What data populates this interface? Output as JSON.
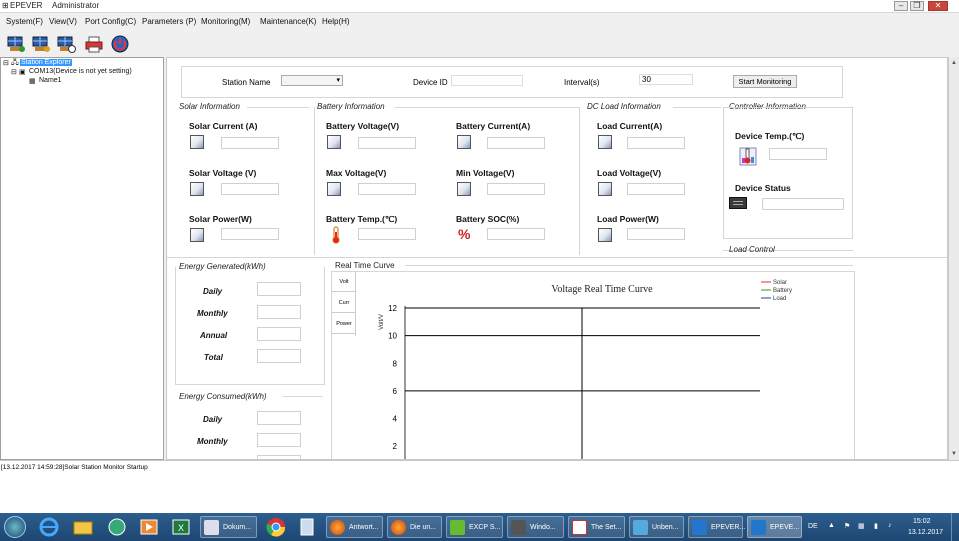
{
  "window": {
    "title_app": "EPEVER",
    "title_user": "Administrator",
    "controls": {
      "minimize": "–",
      "maximize": "❐",
      "close": "✕"
    }
  },
  "menu": [
    "System(F)",
    "View(V)",
    "Port Config(C)",
    "Parameters (P)",
    "Monitoring(M)",
    "Maintenance(K)",
    "Help(H)"
  ],
  "tree": {
    "root": "Station Explorer",
    "port": "COM13(Device is not yet setting)",
    "child": "Name1"
  },
  "station_bar": {
    "station_name_label": "Station Name",
    "device_id_label": "Device ID",
    "interval_label": "Interval(s)",
    "interval_value": "30",
    "start_button": "Start Monitoring"
  },
  "solar": {
    "group": "Solar Information",
    "current": "Solar Current (A)",
    "voltage": "Solar Voltage (V)",
    "power": "Solar Power(W)"
  },
  "battery": {
    "group": "Battery Information",
    "voltage": "Battery Voltage(V)",
    "current": "Battery Current(A)",
    "max_voltage": "Max Voltage(V)",
    "min_voltage": "Min Voltage(V)",
    "temp": "Battery Temp.(℃)",
    "soc": "Battery SOC(%)",
    "soc_icon": "%"
  },
  "dc_load": {
    "group": "DC Load Information",
    "current": "Load Current(A)",
    "voltage": "Load Voltage(V)",
    "power": "Load Power(W)"
  },
  "controller": {
    "group": "Controller Information",
    "temp": "Device Temp.(℃)",
    "status": "Device Status",
    "load_control": "Load Control"
  },
  "energy_generated": {
    "group": "Energy Generated(kWh)",
    "daily": "Daily",
    "monthly": "Monthly",
    "annual": "Annual",
    "total": "Total"
  },
  "energy_consumed": {
    "group": "Energy Consumed(kWh)",
    "daily": "Daily",
    "monthly": "Monthly"
  },
  "curve": {
    "group": "Real Time Curve",
    "tabs": [
      "Volt",
      "Curr",
      "Power"
    ]
  },
  "chart_data": {
    "type": "line",
    "title": "Voltage Real Time Curve",
    "ylabel": "Volt/V",
    "xlabel": "",
    "yticks": [
      2,
      4,
      6,
      8,
      10,
      12
    ],
    "ylim": [
      1,
      12
    ],
    "grid": true,
    "legend_position": "top-right",
    "series": [
      {
        "name": "Solar",
        "color": "#e03030",
        "values": []
      },
      {
        "name": "Battery",
        "color": "#2a9a2a",
        "values": []
      },
      {
        "name": "Load",
        "color": "#2a3aa8",
        "values": []
      }
    ]
  },
  "status_bar": {
    "log": "[13.12.2017 14:59:28]Solar Station Monitor Startup"
  },
  "taskbar": {
    "items": [
      "Dokum...",
      "Antwort...",
      "Die un...",
      "EXCP S...",
      "Windo...",
      "The Set...",
      "Unben...",
      "EPEVER...",
      "EPEVE..."
    ],
    "lang": "DE",
    "time": "15:02",
    "date": "13.12.2017"
  },
  "colors": {
    "titlebar": "#ffffff",
    "tree_selected": "#3399ff",
    "taskbar": "#1e4672",
    "chart_grid": "#000000"
  }
}
